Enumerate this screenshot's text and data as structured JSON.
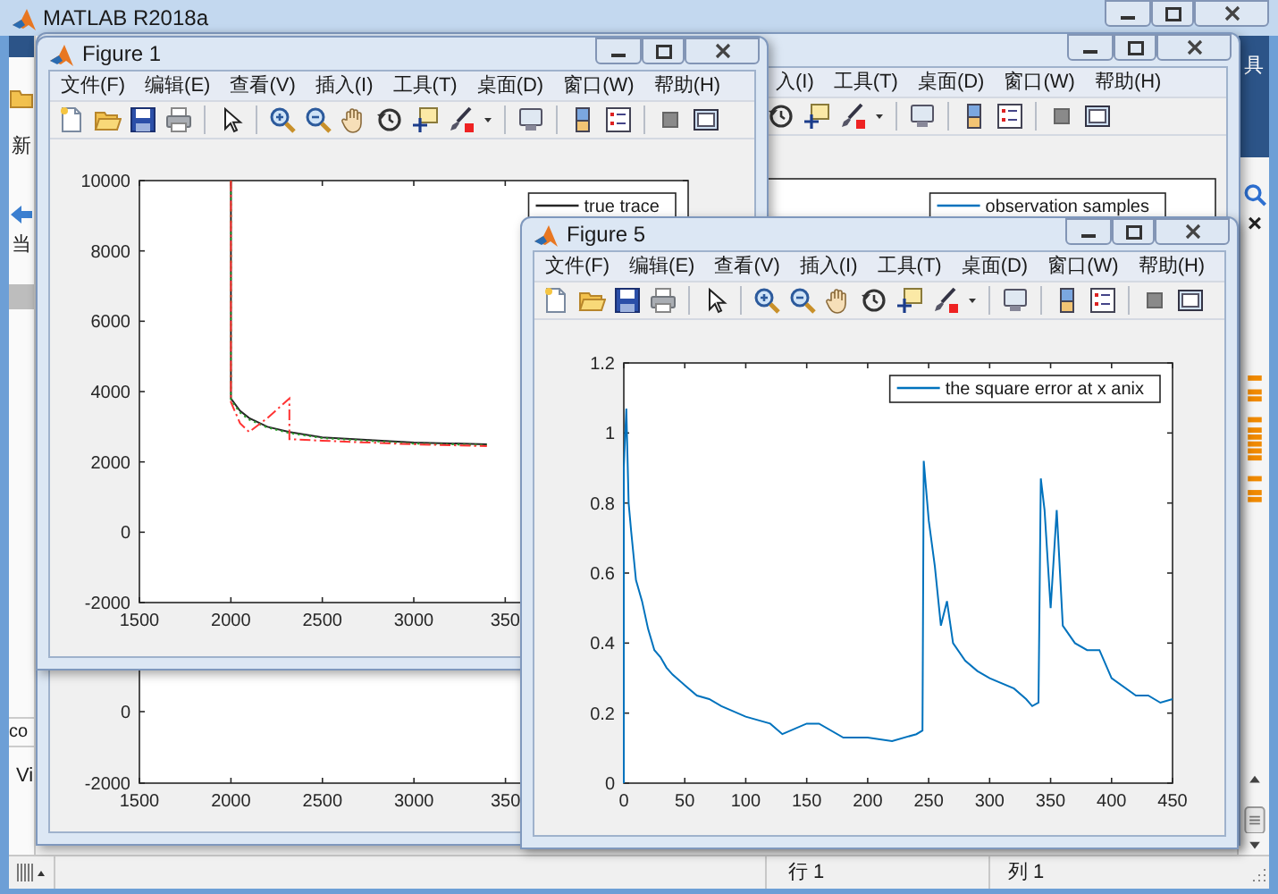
{
  "main_window": {
    "title": "MATLAB R2018a",
    "toolstrip_text": "具",
    "left_panel_texts": [
      "新",
      "当"
    ],
    "left_panel_lower_texts": [
      "co",
      "Vi"
    ],
    "status_bar": {
      "row": "行 1",
      "column": "列 1"
    }
  },
  "back_figure": {
    "menu": [
      "入(I)",
      "工具(T)",
      "桌面(D)",
      "窗口(W)",
      "帮助(H)"
    ],
    "legend": "observation samples",
    "y_tick_labels": [
      "0",
      "-2000"
    ],
    "x_tick_labels": [
      "1500",
      "2000",
      "2500",
      "3000",
      "350"
    ]
  },
  "figures": [
    {
      "title": "Figure 1",
      "cut_x_tick_label": "350",
      "menu": [
        "文件(F)",
        "编辑(E)",
        "查看(V)",
        "插入(I)",
        "工具(T)",
        "桌面(D)",
        "窗口(W)",
        "帮助(H)"
      ],
      "chart_data": {
        "type": "line",
        "xlim": [
          1500,
          4500
        ],
        "ylim": [
          -2000,
          10000
        ],
        "xticks": [
          1500,
          2000,
          2500,
          3000
        ],
        "yticks": [
          -2000,
          0,
          2000,
          4000,
          6000,
          8000,
          10000
        ],
        "x": [
          2000,
          2000,
          2050,
          2100,
          2200,
          2320,
          2320,
          2500,
          3000,
          3400
        ],
        "series": [
          {
            "name": "true trace",
            "color": "#262626",
            "line_style": "solid",
            "values": [
              10000,
              3800,
              3450,
              3250,
              3000,
              2850,
              2850,
              2700,
              2550,
              2500
            ]
          },
          {
            "color": "#2ca02c",
            "line_style": "dotted",
            "values": [
              10000,
              3750,
              3400,
              3200,
              2980,
              2820,
              2820,
              2680,
              2520,
              2480
            ]
          },
          {
            "color": "#ff3333",
            "line_style": "dashdot",
            "values": [
              10000,
              3700,
              3100,
              2850,
              3250,
              3800,
              2650,
              2600,
              2500,
              2450
            ]
          }
        ]
      }
    },
    {
      "title": "Figure 5",
      "menu": [
        "文件(F)",
        "编辑(E)",
        "查看(V)",
        "插入(I)",
        "工具(T)",
        "桌面(D)",
        "窗口(W)",
        "帮助(H)"
      ],
      "chart_data": {
        "type": "line",
        "xlim": [
          0,
          450
        ],
        "ylim": [
          0,
          1.2
        ],
        "xticks": [
          0,
          50,
          100,
          150,
          200,
          250,
          300,
          350,
          400,
          450
        ],
        "yticks": [
          0,
          0.2,
          0.4,
          0.6,
          0.8,
          1,
          1.2
        ],
        "x": [
          0,
          0,
          2,
          4,
          6,
          10,
          15,
          20,
          25,
          30,
          35,
          40,
          50,
          60,
          70,
          80,
          100,
          120,
          130,
          150,
          160,
          180,
          200,
          220,
          240,
          245,
          246,
          250,
          255,
          260,
          265,
          270,
          280,
          290,
          300,
          320,
          330,
          335,
          340,
          342,
          345,
          350,
          355,
          360,
          370,
          380,
          390,
          400,
          420,
          430,
          440,
          450
        ],
        "series": [
          {
            "name": "the square error at x anix",
            "color": "#0072bd",
            "line_style": "solid",
            "values": [
              0,
              0.9,
              1.07,
              0.8,
              0.72,
              0.58,
              0.52,
              0.44,
              0.38,
              0.36,
              0.33,
              0.31,
              0.28,
              0.25,
              0.24,
              0.22,
              0.19,
              0.17,
              0.14,
              0.17,
              0.17,
              0.13,
              0.13,
              0.12,
              0.14,
              0.15,
              0.92,
              0.75,
              0.62,
              0.45,
              0.52,
              0.4,
              0.35,
              0.32,
              0.3,
              0.27,
              0.24,
              0.22,
              0.23,
              0.87,
              0.78,
              0.5,
              0.78,
              0.45,
              0.4,
              0.38,
              0.38,
              0.3,
              0.25,
              0.25,
              0.23,
              0.24
            ]
          }
        ]
      }
    }
  ]
}
